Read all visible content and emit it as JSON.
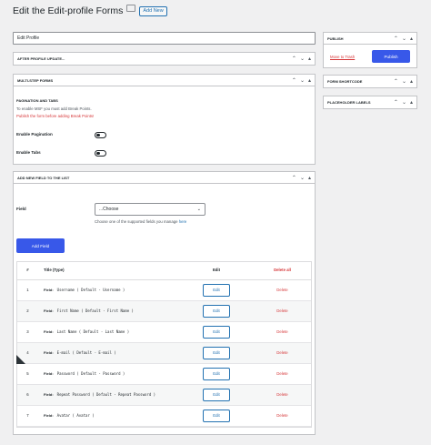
{
  "header": {
    "title": "Edit the Edit-profile Forms",
    "add_new": "Add New"
  },
  "form_title_value": "Edit Profile",
  "after_update": {
    "title": "AFTER PROFILE UPDATE..."
  },
  "multistep": {
    "title": "MULTI-STEP FORMS",
    "section_title": "PAGINATION AND TABS",
    "info": "To enable MSF you must add Break Points.",
    "warning": "Publish the form before adding Break Points!",
    "enable_pagination": "Enable Pagination",
    "enable_tabs": "Enable Tabs"
  },
  "add_field_box": {
    "title": "ADD NEW FIELD TO THE LIST",
    "field_label": "Field",
    "select_value": "...Choose",
    "help_prefix": "Choose one of the supported fields you manage ",
    "help_link": "here",
    "add_button": "Add Field"
  },
  "table": {
    "headers": {
      "num": "#",
      "title": "Title (Type)",
      "edit": "Edit",
      "delete_all": "Delete all"
    },
    "field_tag": "Field:",
    "edit_label": "Edit",
    "delete_label": "Delete",
    "rows": [
      {
        "num": "1",
        "title": "Username ( Default - Username )"
      },
      {
        "num": "2",
        "title": "First Name ( Default - First Name )"
      },
      {
        "num": "3",
        "title": "Last Name ( Default - Last Name )"
      },
      {
        "num": "4",
        "title": "E-mail ( Default - E-mail )"
      },
      {
        "num": "5",
        "title": "Password ( Default - Password )"
      },
      {
        "num": "6",
        "title": "Repeat Password ( Default - Repeat Password )"
      },
      {
        "num": "7",
        "title": "Avatar ( Avatar )"
      }
    ]
  },
  "publish": {
    "title": "PUBLISH",
    "trash": "Move to Trash",
    "button": "Publish"
  },
  "form_shortcode": {
    "title": "FORM SHORTCODE"
  },
  "placeholder_labels": {
    "title": "PLACEHOLDER LABELS"
  },
  "colors": {
    "primary": "#3858e9",
    "danger": "#d63638",
    "link": "#2271b1"
  }
}
